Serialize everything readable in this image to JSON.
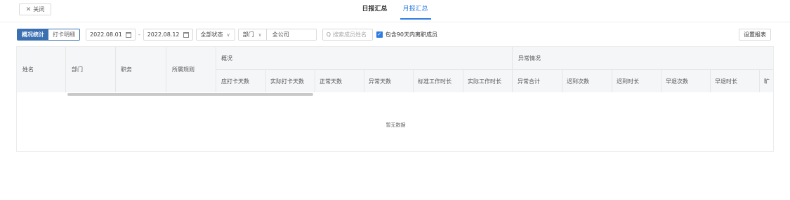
{
  "topbar": {
    "close_label": "关闭",
    "tabs": [
      {
        "label": "日报汇总",
        "active": false
      },
      {
        "label": "月报汇总",
        "active": true
      }
    ]
  },
  "filters": {
    "view_tabs": [
      {
        "label": "概况统计",
        "active": true
      },
      {
        "label": "打卡明细",
        "active": false
      }
    ],
    "date_start": "2022.08.01",
    "date_end": "2022.08.12",
    "status_select": "全部状态",
    "dept_label": "部门",
    "dept_value": "全公司",
    "search_placeholder": "搜索成员姓名",
    "include_resigned_label": "包含90天内离职成员",
    "include_resigned_checked": true,
    "settings_label": "设置报表"
  },
  "table": {
    "fixed_columns": [
      "姓名",
      "部门",
      "职务",
      "所属规则"
    ],
    "groups": [
      {
        "label": "概况",
        "columns": [
          "应打卡天数",
          "实际打卡天数",
          "正常天数",
          "异常天数",
          "标准工作时长",
          "实际工作时长"
        ]
      },
      {
        "label": "异常情况",
        "columns": [
          "异常合计",
          "迟到次数",
          "迟到时长",
          "早退次数",
          "早退时长",
          "旷"
        ]
      }
    ],
    "empty_text": "暂无数据"
  },
  "colors": {
    "accent": "#2f7de1",
    "segment_active": "#3a6fb0",
    "header_bg": "#f5f6f8"
  }
}
